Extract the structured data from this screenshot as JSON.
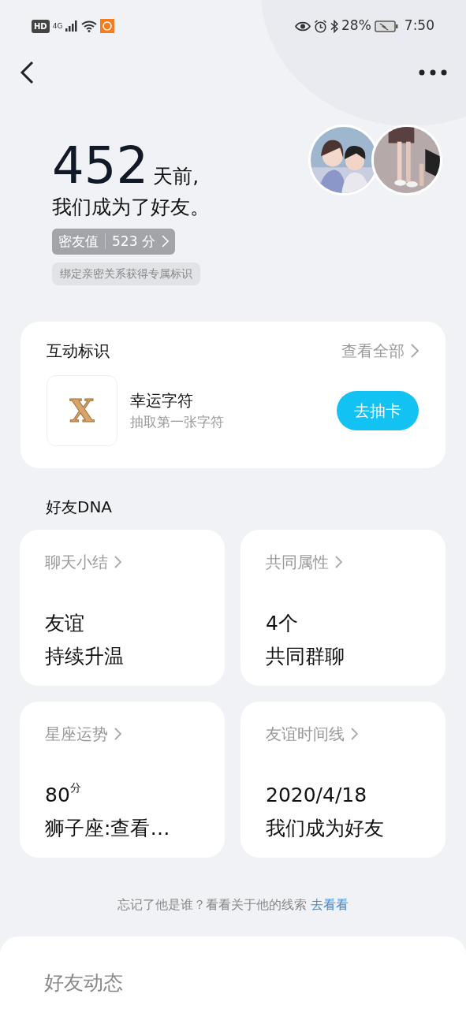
{
  "status_bar": {
    "hd": "HD",
    "network": "4G",
    "battery": "28%",
    "time": "7:50"
  },
  "hero": {
    "days": "452",
    "days_suffix": "天前,",
    "line2": "我们成为了好友。",
    "score_label": "密友值",
    "score": "523 分",
    "hint": "绑定亲密关系获得专属标识"
  },
  "interaction": {
    "title": "互动标识",
    "view_all": "查看全部",
    "badge_letter": "X",
    "item_title": "幸运字符",
    "item_subtitle": "抽取第一张字符",
    "button": "去抽卡"
  },
  "dna": {
    "title": "好友DNA",
    "cards": [
      {
        "title": "聊天小结",
        "line1": "友谊",
        "line2": "持续升温"
      },
      {
        "title": "共同属性",
        "line1": "4个",
        "line2": "共同群聊"
      },
      {
        "title": "星座运势",
        "line1": "80$^{分}$",
        "line2": "狮子座:查看…"
      },
      {
        "title": "友谊时间线",
        "line1": "2020/4/18",
        "line2": "我们成为好友"
      }
    ]
  },
  "footer": {
    "text": "忘记了他是谁？看看关于他的线索",
    "link": "去看看"
  },
  "feed": {
    "title": "好友动态"
  }
}
